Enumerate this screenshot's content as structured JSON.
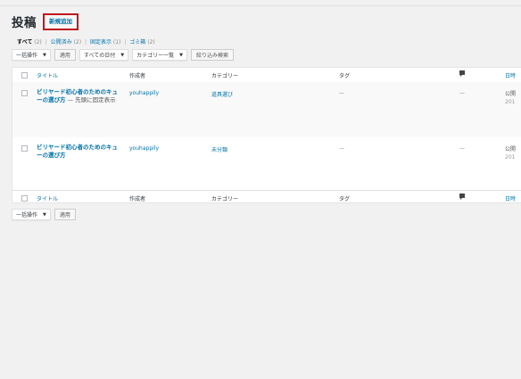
{
  "header": {
    "title": "投稿",
    "add_new_label": "新規追加"
  },
  "views": {
    "all_label": "すべて",
    "all_count": "(2)",
    "publish_label": "公開済み",
    "publish_count": "(2)",
    "sticky_label": "固定表示",
    "sticky_count": "(1)",
    "trash_label": "ゴミ箱",
    "trash_count": "(2)",
    "separator": "|"
  },
  "tablenav_top": {
    "bulk_action": "一括操作",
    "apply_label": "適用",
    "date_filter": "すべての日付",
    "category_filter": "カテゴリー一覧",
    "filter_label": "絞り込み検索"
  },
  "columns": {
    "title": "タイトル",
    "author": "作成者",
    "categories": "カテゴリー",
    "tags": "タグ",
    "comments_icon": "comment-bubble-icon",
    "date": "日時"
  },
  "posts": [
    {
      "title": "ビリヤード初心者のためのキューの選び方",
      "state": " — 先頭に固定表示",
      "author": "youhappily",
      "category": "道具選び",
      "tags": "—",
      "comments": "—",
      "date_status": "公開",
      "date_value": "201"
    },
    {
      "title": "ビリヤード初心者のためのキューの選び方",
      "state": "",
      "author": "youhappily",
      "category": "未分類",
      "tags": "—",
      "comments": "—",
      "date_status": "公開",
      "date_value": "201"
    }
  ],
  "tablenav_bottom": {
    "bulk_action": "一括操作",
    "apply_label": "適用"
  },
  "colors": {
    "link": "#0073aa",
    "highlight_border": "#c0171c",
    "background": "#f1f1f1"
  }
}
